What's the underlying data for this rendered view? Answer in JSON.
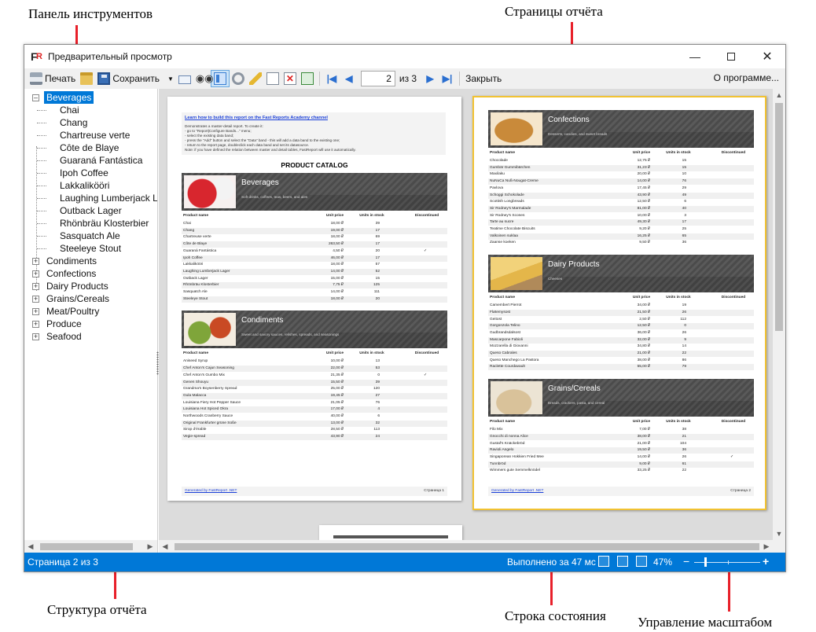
{
  "callouts": {
    "toolbar": "Панель инструментов",
    "pages": "Страницы отчёта",
    "structure": "Структура отчёта",
    "status": "Строка состояния",
    "zoom": "Управление масштабом"
  },
  "window": {
    "title": "Предварительный просмотр"
  },
  "toolbar": {
    "print": "Печать",
    "save": "Сохранить",
    "page_value": "2",
    "of_pages": "из 3",
    "close": "Закрыть",
    "about": "О программе..."
  },
  "tree": {
    "root": "Beverages",
    "children": [
      "Chai",
      "Chang",
      "Chartreuse verte",
      "Côte de Blaye",
      "Guaraná Fantástica",
      "Ipoh Coffee",
      "Lakkalikööri",
      "Laughing Lumberjack Lager",
      "Outback Lager",
      "Rhönbräu Klosterbier",
      "Sasquatch Ale",
      "Steeleye Stout"
    ],
    "categories": [
      "Condiments",
      "Confections",
      "Dairy Products",
      "Grains/Cereals",
      "Meat/Poultry",
      "Produce",
      "Seafood"
    ]
  },
  "report": {
    "hint_title": "Learn how to build this report on the Fast Reports Academy channel",
    "hint_lines": [
      "Demonstrates a master-detail report. To create it:",
      "- go to \"Report|Configure Bands...\" menu;",
      "- select the existing data band;",
      "- press the \"Add\" button and select the \"Data\" band - this will add a data band to the existing one;",
      "- return to the report page, doubleclick each data band and set its datasource.",
      "Note: if you have defined the relation between master and detail tables, FastReport will use it automatically."
    ],
    "catalog_title": "PRODUCT CATALOG",
    "columns": [
      "Product name",
      "Unit price",
      "Units in stock",
      "Discontinued"
    ],
    "generated": "Generated by FastReport .NET",
    "page1_label": "Страница 1",
    "page2_label": "Страница 2",
    "page1": [
      {
        "name": "Beverages",
        "desc": "Soft drinks, coffees, teas, beers, and ales",
        "rows": [
          [
            "Chai",
            "18,00 ₽",
            "39",
            ""
          ],
          [
            "Chang",
            "19,00 ₽",
            "17",
            ""
          ],
          [
            "Chartreuse verte",
            "18,00 ₽",
            "69",
            ""
          ],
          [
            "Côte de Blaye",
            "263,50 ₽",
            "17",
            ""
          ],
          [
            "Guaraná Fantástica",
            "4,50 ₽",
            "20",
            "✓"
          ],
          [
            "Ipoh Coffee",
            "46,00 ₽",
            "17",
            ""
          ],
          [
            "Lakkalikööri",
            "18,00 ₽",
            "57",
            ""
          ],
          [
            "Laughing Lumberjack Lager",
            "14,00 ₽",
            "52",
            ""
          ],
          [
            "Outback Lager",
            "15,00 ₽",
            "15",
            ""
          ],
          [
            "Rhönbräu Klosterbier",
            "7,75 ₽",
            "125",
            ""
          ],
          [
            "Sasquatch Ale",
            "14,00 ₽",
            "111",
            ""
          ],
          [
            "Steeleye Stout",
            "18,00 ₽",
            "20",
            ""
          ]
        ]
      },
      {
        "name": "Condiments",
        "desc": "Sweet and savory sauces, relishes, spreads, and seasonings",
        "rows": [
          [
            "Aniseed Syrup",
            "10,00 ₽",
            "13",
            ""
          ],
          [
            "Chef Anton's Cajun Seasoning",
            "22,00 ₽",
            "53",
            ""
          ],
          [
            "Chef Anton's Gumbo Mix",
            "21,35 ₽",
            "0",
            "✓"
          ],
          [
            "Genen Shouyu",
            "15,50 ₽",
            "39",
            ""
          ],
          [
            "Grandma's Boysenberry Spread",
            "25,00 ₽",
            "120",
            ""
          ],
          [
            "Gula Malacca",
            "19,45 ₽",
            "27",
            ""
          ],
          [
            "Louisiana Fiery Hot Pepper Sauce",
            "21,05 ₽",
            "76",
            ""
          ],
          [
            "Louisiana Hot Spiced Okra",
            "17,00 ₽",
            "4",
            ""
          ],
          [
            "Northwoods Cranberry Sauce",
            "40,00 ₽",
            "6",
            ""
          ],
          [
            "Original Frankfurter grüne Soße",
            "13,00 ₽",
            "32",
            ""
          ],
          [
            "Sirop d'érable",
            "28,50 ₽",
            "113",
            ""
          ],
          [
            "Vegie-spread",
            "43,90 ₽",
            "24",
            ""
          ]
        ]
      }
    ],
    "page2": [
      {
        "name": "Confections",
        "desc": "Desserts, candies, and sweet breads",
        "rows": [
          [
            "Chocolade",
            "12,75 ₽",
            "15",
            ""
          ],
          [
            "Gumbär Gummibärchen",
            "31,23 ₽",
            "15",
            ""
          ],
          [
            "Maxilaku",
            "20,00 ₽",
            "10",
            ""
          ],
          [
            "NuNuCa Nuß-Nougat-Creme",
            "14,00 ₽",
            "76",
            ""
          ],
          [
            "Pavlova",
            "17,45 ₽",
            "29",
            ""
          ],
          [
            "Schoggi Schokolade",
            "43,90 ₽",
            "49",
            ""
          ],
          [
            "Scottish Longbreads",
            "12,50 ₽",
            "6",
            ""
          ],
          [
            "Sir Rodney's Marmalade",
            "81,00 ₽",
            "40",
            ""
          ],
          [
            "Sir Rodney's Scones",
            "10,00 ₽",
            "3",
            ""
          ],
          [
            "Tarte au sucre",
            "49,30 ₽",
            "17",
            ""
          ],
          [
            "Teatime Chocolate Biscuits",
            "9,20 ₽",
            "25",
            ""
          ],
          [
            "Valkoinen suklaa",
            "16,25 ₽",
            "65",
            ""
          ],
          [
            "Zaanse koeken",
            "9,50 ₽",
            "36",
            ""
          ]
        ]
      },
      {
        "name": "Dairy Products",
        "desc": "Cheeses",
        "rows": [
          [
            "Camembert Pierrot",
            "34,00 ₽",
            "19",
            ""
          ],
          [
            "Fløtemysost",
            "21,50 ₽",
            "26",
            ""
          ],
          [
            "Geitost",
            "2,50 ₽",
            "112",
            ""
          ],
          [
            "Gorgonzola Telino",
            "12,50 ₽",
            "0",
            ""
          ],
          [
            "Gudbrandsdalsost",
            "36,00 ₽",
            "26",
            ""
          ],
          [
            "Mascarpone Fabioli",
            "32,00 ₽",
            "9",
            ""
          ],
          [
            "Mozzarella di Giovanni",
            "34,80 ₽",
            "14",
            ""
          ],
          [
            "Queso Cabrales",
            "21,00 ₽",
            "22",
            ""
          ],
          [
            "Queso Manchego La Pastora",
            "38,00 ₽",
            "86",
            ""
          ],
          [
            "Raclette Courdavault",
            "55,00 ₽",
            "79",
            ""
          ]
        ]
      },
      {
        "name": "Grains/Cereals",
        "desc": "Breads, crackers, pasta, and cereal",
        "rows": [
          [
            "Filo Mix",
            "7,00 ₽",
            "38",
            ""
          ],
          [
            "Gnocchi di nonna Alice",
            "38,00 ₽",
            "21",
            ""
          ],
          [
            "Gustaf's Knäckebröd",
            "21,00 ₽",
            "104",
            ""
          ],
          [
            "Ravioli Angelo",
            "19,50 ₽",
            "36",
            ""
          ],
          [
            "Singaporean Hokkien Fried Mee",
            "14,00 ₽",
            "26",
            "✓"
          ],
          [
            "Tunnbröd",
            "9,00 ₽",
            "61",
            ""
          ],
          [
            "Wimmers gute Semmelknödel",
            "33,25 ₽",
            "22",
            ""
          ]
        ]
      }
    ]
  },
  "status": {
    "page_info": "Страница 2 из 3",
    "elapsed": "Выполнено за 47 мс",
    "zoom": "47%",
    "minus": "−",
    "plus": "+"
  },
  "colors": {
    "accent": "#0078d7",
    "arrow": "#e8202a",
    "selected_page_border": "#f1c232"
  }
}
